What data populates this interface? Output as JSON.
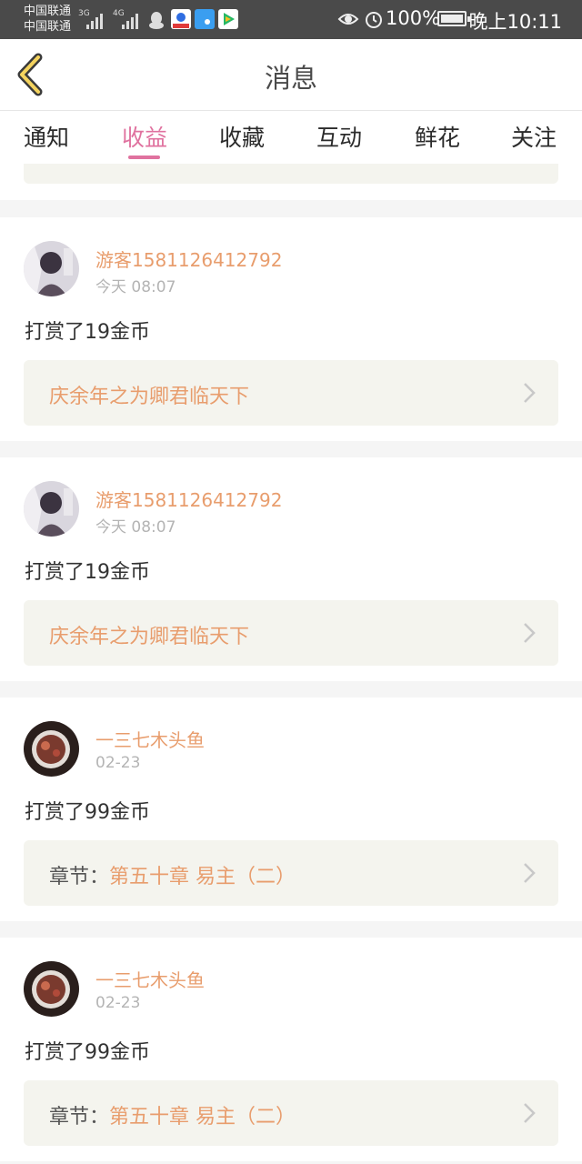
{
  "status_bar": {
    "carrier1": "中国联通",
    "carrier2": "中国联通",
    "net1": "3G",
    "net2": "4G",
    "battery": "100%",
    "time": "晚上10:11"
  },
  "header": {
    "title": "消息"
  },
  "tabs": [
    {
      "label": "通知",
      "active": false
    },
    {
      "label": "收益",
      "active": true
    },
    {
      "label": "收藏",
      "active": false
    },
    {
      "label": "互动",
      "active": false
    },
    {
      "label": "鲜花",
      "active": false
    },
    {
      "label": "关注",
      "active": false
    }
  ],
  "colors": {
    "accent": "#e0729f",
    "username": "#e89d6d",
    "status_bar": "#4a4a4a",
    "card_box": "#f4f4ee"
  },
  "items": [
    {
      "user": "游客1581126412792",
      "time": "今天 08:07",
      "reward": "打赏了19金币",
      "link_prefix": "",
      "link_title": "庆余年之为卿君临天下",
      "avatar": "anime-avatar-icon"
    },
    {
      "user": "游客1581126412792",
      "time": "今天 08:07",
      "reward": "打赏了19金币",
      "link_prefix": "",
      "link_title": "庆余年之为卿君临天下",
      "avatar": "anime-avatar-icon"
    },
    {
      "user": "一三七木头鱼",
      "time": "02-23",
      "reward": "打赏了99金币",
      "link_prefix": "章节：",
      "link_title": "第五十章 易主（二）",
      "avatar": "coffee-avatar-icon"
    },
    {
      "user": "一三七木头鱼",
      "time": "02-23",
      "reward": "打赏了99金币",
      "link_prefix": "章节：",
      "link_title": "第五十章 易主（二）",
      "avatar": "coffee-avatar-icon"
    }
  ]
}
